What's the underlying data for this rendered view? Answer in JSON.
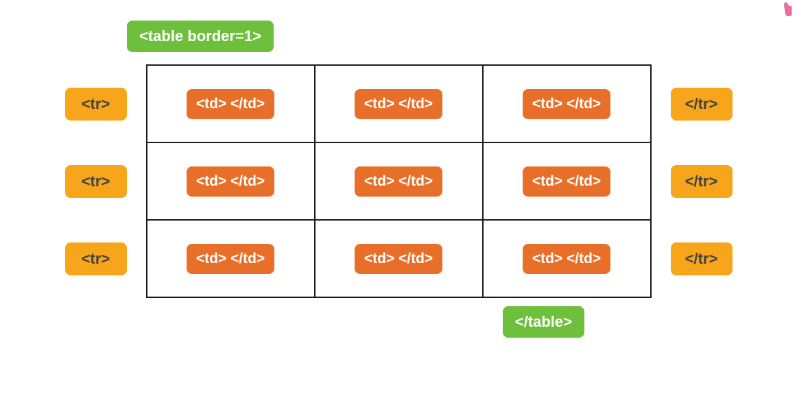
{
  "tags": {
    "table_open": "<table border=1>",
    "table_close": "</table>",
    "tr_open": "<tr>",
    "tr_close": "</tr>",
    "td_pair": "<td> </td>"
  },
  "grid": {
    "rows": 3,
    "cols": 3
  },
  "colors": {
    "green": "#6ec03c",
    "yellow": "#f7a61b",
    "orange": "#e86f29",
    "border": "#1a1a1a"
  }
}
